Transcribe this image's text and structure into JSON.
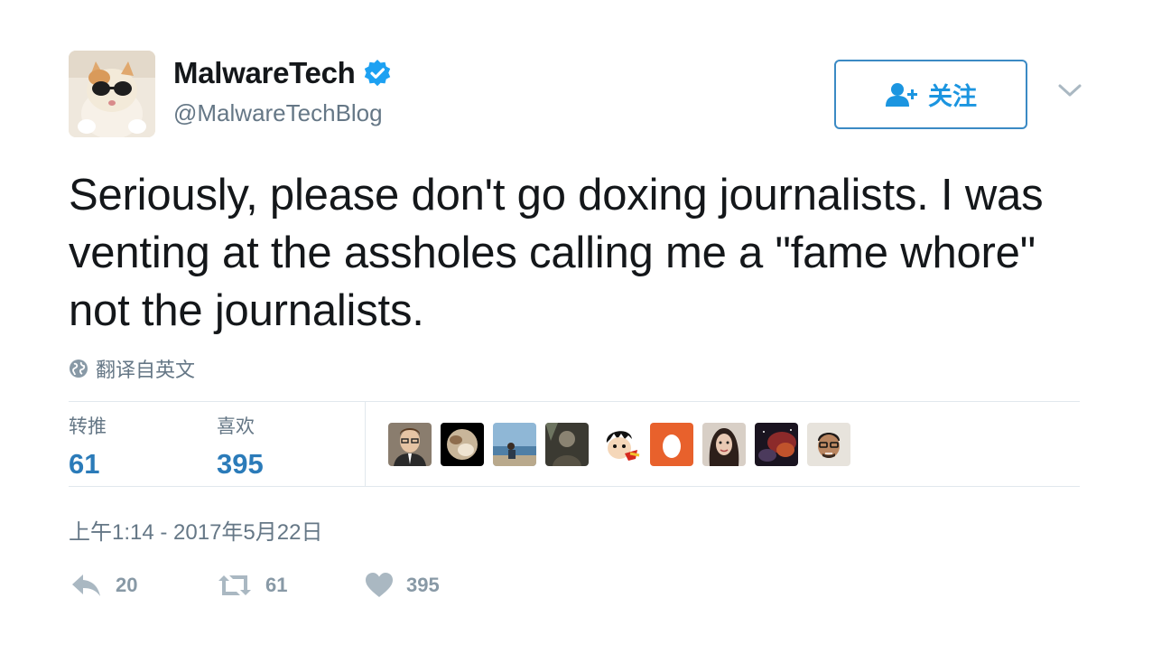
{
  "author": {
    "display_name": "MalwareTech",
    "handle": "@MalwareTechBlog",
    "verified": true
  },
  "follow_button": {
    "label": "关注"
  },
  "tweet": {
    "text": "Seriously, please don't go doxing journalists. I was venting at the assholes calling me a \"fame whore\" not the journalists.",
    "translate_label": "翻译自英文",
    "timestamp": "上午1:14 - 2017年5月22日"
  },
  "stats": {
    "retweets_label": "转推",
    "retweets_count": "61",
    "likes_label": "喜欢",
    "likes_count": "395"
  },
  "likers": [
    {
      "icon": "avatar-man-glasses"
    },
    {
      "icon": "avatar-pluto"
    },
    {
      "icon": "avatar-beach"
    },
    {
      "icon": "avatar-dark-figure"
    },
    {
      "icon": "avatar-cartoon"
    },
    {
      "icon": "avatar-default-egg"
    },
    {
      "icon": "avatar-woman"
    },
    {
      "icon": "avatar-red-nebula"
    },
    {
      "icon": "avatar-cartoon-man-glasses"
    }
  ],
  "actions": {
    "reply_count": "20",
    "retweet_count": "61",
    "like_count": "395"
  },
  "colors": {
    "brand_blue": "#1b95e0",
    "stat_blue": "#2b7bb9",
    "muted_gray": "#657786",
    "action_gray": "#8899a6",
    "egg_orange": "#e8612c"
  }
}
